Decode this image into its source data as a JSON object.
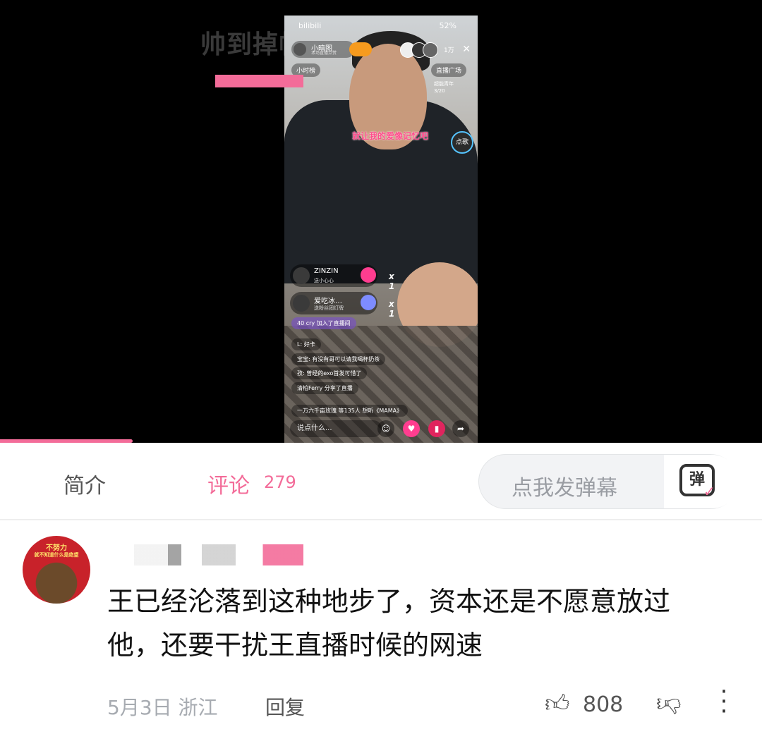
{
  "video": {
    "watermark_left": "帅到掉帧",
    "app_mark": "bilibili",
    "status": "52%",
    "host_name": "小暗图",
    "host_sub": "本场直播点赞",
    "viewer_count": "1万",
    "close": "✕",
    "tag_left": "小时榜",
    "tag_right": "直播广场",
    "rank_line1": "超能青年",
    "rank_line2": "3/20",
    "lyric": "就让我的爱像记忆吧",
    "song_button": "点歌",
    "gifts": [
      {
        "name": "ZINZIN",
        "desc": "送小心心",
        "count": "x 1"
      },
      {
        "name": "爱吃冰…",
        "desc": "送粉丝团灯牌",
        "count": "x 1"
      }
    ],
    "messages": [
      {
        "text": "40  cry 加入了直播间"
      },
      {
        "text": "L:  好卡"
      },
      {
        "text": "宝宝: 有没有哥可以请我喝杯奶茶"
      },
      {
        "text": "孜: 曾经的exo首发可惜了"
      },
      {
        "text": "清柏Ferry 分享了直播"
      }
    ],
    "ticker": "一万六千亩玫瑰    等135人 想听《MAMA》",
    "input_placeholder": "说点什么...",
    "progress_fraction": 0.174
  },
  "tabs": {
    "intro": "简介",
    "comment": "评论",
    "comment_count": "279",
    "danmaku_placeholder": "点我发弹幕",
    "danmaku_icon": "弹"
  },
  "comment": {
    "avatar_line1": "不努力",
    "avatar_line2": "就不知道什么是绝望",
    "text": "王已经沦落到这种地步了，资本还是不愿意放过他，还要干扰王直播时候的网速",
    "date": "5月3日 浙江",
    "reply": "回复",
    "like_count": "808"
  },
  "icons": {
    "like": "thumbs-up-icon",
    "dislike": "thumbs-down-icon",
    "more": "more-vertical-icon"
  },
  "colors": {
    "accent": "#f36c99",
    "muted": "#a7abb1"
  }
}
